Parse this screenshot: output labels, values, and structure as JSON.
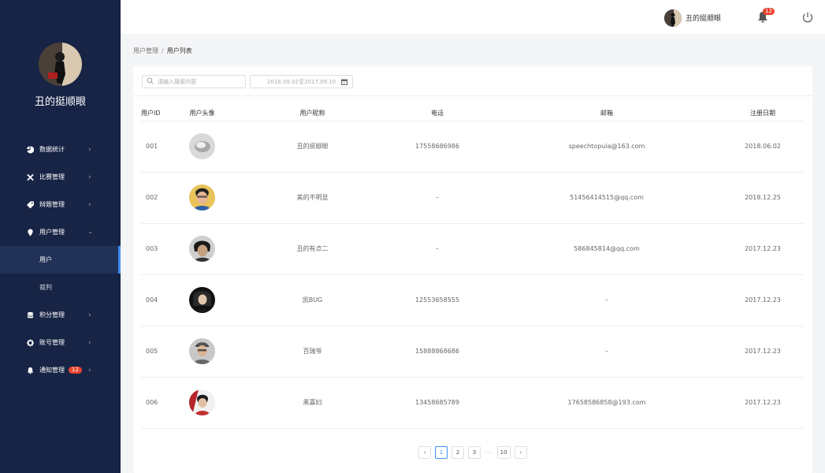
{
  "sidebar": {
    "user_name": "丑的挺顺眼",
    "items": [
      {
        "label": "数据统计",
        "icon": "pie-chart-icon"
      },
      {
        "label": "比赛管理",
        "icon": "close-cross-icon"
      },
      {
        "label": "辩题管理",
        "icon": "tag-icon"
      },
      {
        "label": "用户管理",
        "icon": "location-pin-icon"
      },
      {
        "label": "积分管理",
        "icon": "database-icon"
      },
      {
        "label": "账号管理",
        "icon": "gear-icon"
      },
      {
        "label": "通知管理",
        "icon": "bell-icon",
        "badge": "12"
      }
    ],
    "sub_items": [
      {
        "label": "用户"
      },
      {
        "label": "裁判"
      }
    ],
    "colors": {
      "bg": "#172445",
      "active_bg": "#213158",
      "accent": "#3f8ef5"
    }
  },
  "header": {
    "user_name": "丑的挺顺眼",
    "notification_count": "12"
  },
  "breadcrumb": {
    "parent": "用户管理",
    "separator": "/",
    "current": "用户列表"
  },
  "toolbar": {
    "search_placeholder": "请输入搜索内容",
    "date_range": "2018.09.02至2017.09.10"
  },
  "table": {
    "headers": {
      "id": "用户ID",
      "avatar": "用户头像",
      "nickname": "用户昵称",
      "phone": "电话",
      "email": "邮箱",
      "date": "注册日期"
    },
    "rows": [
      {
        "id": "001",
        "nickname": "丑的挺顺眼",
        "phone": "17558686986",
        "email": "speechtopuia@163.com",
        "date": "2018.06.02"
      },
      {
        "id": "002",
        "nickname": "美的不明显",
        "phone": "–",
        "email": "51456414515@qq.com",
        "date": "2018.12.25"
      },
      {
        "id": "003",
        "nickname": "丑的有点二",
        "phone": "–",
        "email": "586845814@qq.com",
        "date": "2017.12.23"
      },
      {
        "id": "004",
        "nickname": "凯BUG",
        "phone": "12553658555",
        "email": "–",
        "date": "2017.12.23"
      },
      {
        "id": "005",
        "nickname": "百瑞爷",
        "phone": "15888868686",
        "email": "–",
        "date": "2017.12.23"
      },
      {
        "id": "006",
        "nickname": "黑寡妇",
        "phone": "13458685789",
        "email": "17658586858@193.com",
        "date": "2017.12.23"
      }
    ]
  },
  "pagination": {
    "prev": "‹",
    "pages": [
      "1",
      "2",
      "3"
    ],
    "ellipsis": "···",
    "last": "10",
    "next": "›",
    "current": "1"
  }
}
